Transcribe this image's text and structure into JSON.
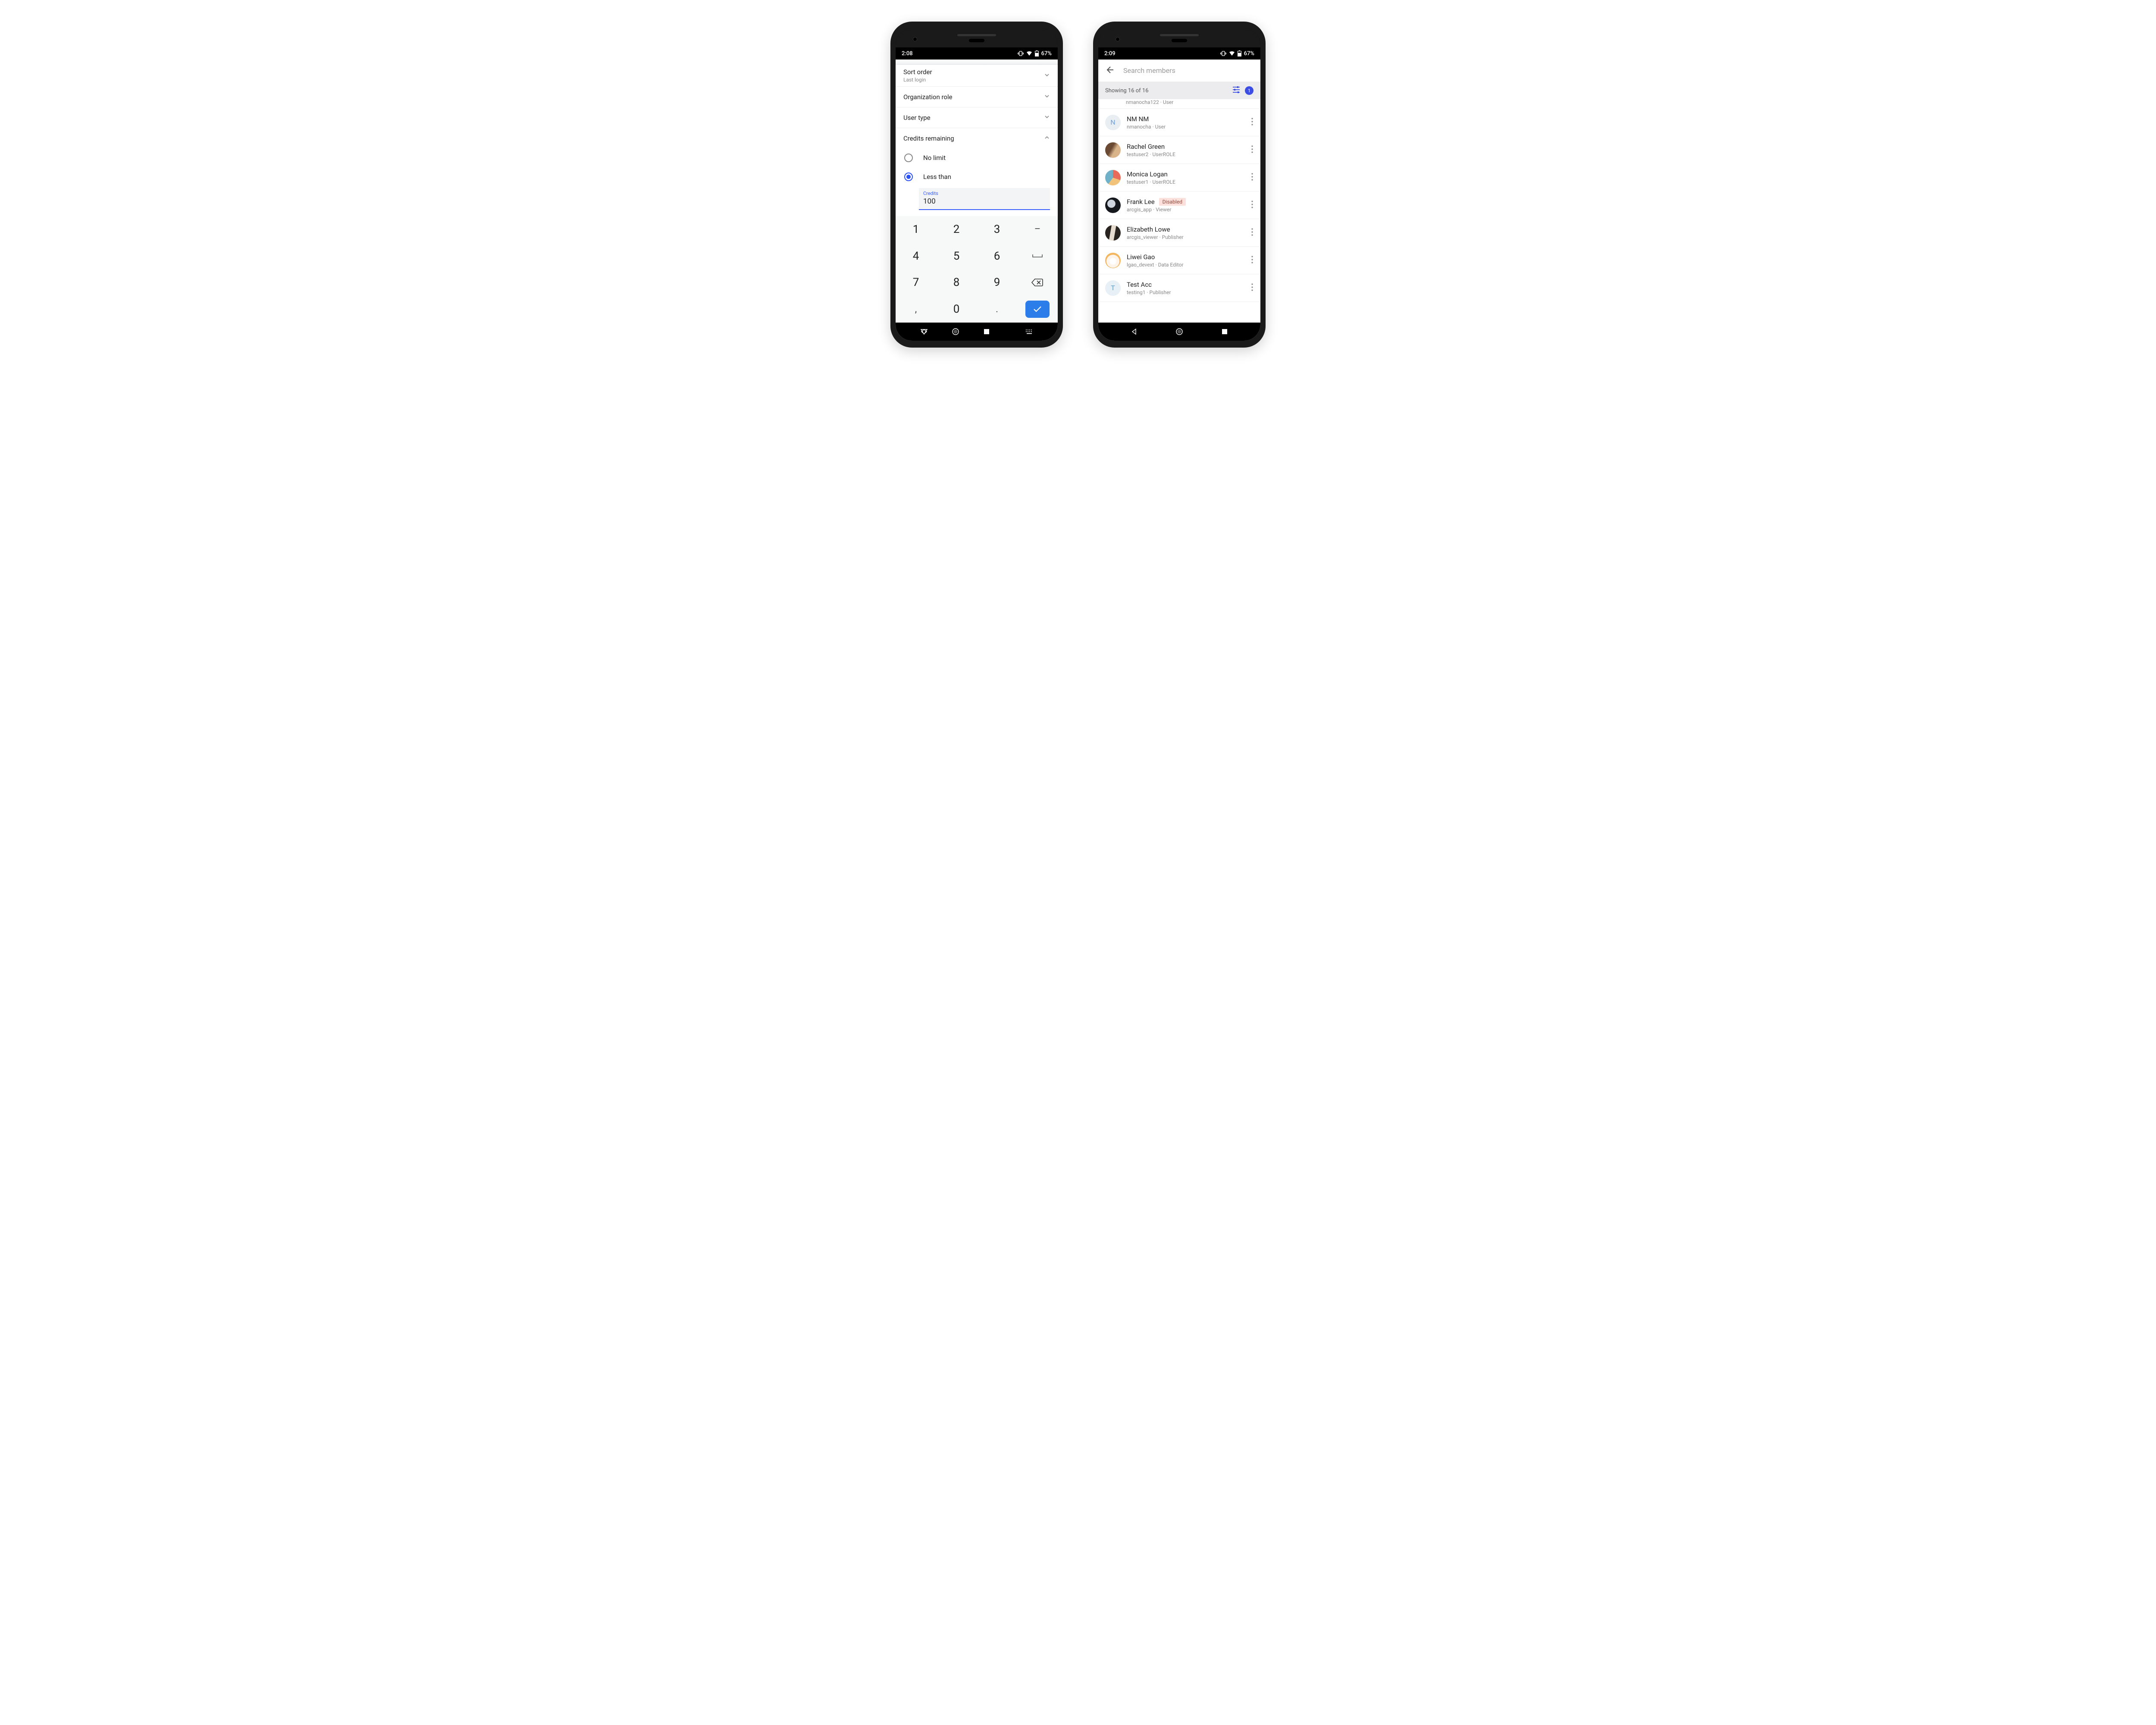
{
  "phone1": {
    "status": {
      "time": "2:08",
      "battery": "67%"
    },
    "filters": {
      "sort_order": {
        "label": "Sort order",
        "value": "Last login"
      },
      "org_role": {
        "label": "Organization role"
      },
      "user_type": {
        "label": "User type"
      },
      "credits": {
        "label": "Credits remaining",
        "options": {
          "no_limit": "No limit",
          "less_than": "Less than"
        },
        "input_caption": "Credits",
        "input_value": "100"
      }
    },
    "keypad": {
      "k1": "1",
      "k2": "2",
      "k3": "3",
      "kdash": "–",
      "k4": "4",
      "k5": "5",
      "k6": "6",
      "k7": "7",
      "k8": "8",
      "k9": "9",
      "kcomma": ",",
      "k0": "0",
      "kdot": "."
    }
  },
  "phone2": {
    "status": {
      "time": "2:09",
      "battery": "67%"
    },
    "search_placeholder": "Search members",
    "summary": {
      "text": "Showing 16 of 16",
      "badge": "1"
    },
    "partial_row_sub": "nmanocha122 · User",
    "members": [
      {
        "name": "NM NM",
        "sub": "nmanocha · User",
        "avatar_class": "av-letter-n",
        "initial": "N",
        "disabled": false
      },
      {
        "name": "Rachel Green",
        "sub": "testuser2 · UserROLE",
        "avatar_class": "av-rachel",
        "initial": "",
        "disabled": false
      },
      {
        "name": "Monica Logan",
        "sub": "testuser1 · UserROLE",
        "avatar_class": "av-monica",
        "initial": "",
        "disabled": false
      },
      {
        "name": "Frank Lee",
        "sub": "arcgis_app · Viewer",
        "avatar_class": "av-frank",
        "initial": "",
        "disabled": true,
        "badge": "Disabled"
      },
      {
        "name": "Elizabeth Lowe",
        "sub": "arcgis_viewer · Publisher",
        "avatar_class": "av-eliz",
        "initial": "",
        "disabled": false
      },
      {
        "name": "Liwei Gao",
        "sub": "lgao_devext · Data Editor",
        "avatar_class": "av-liwei",
        "initial": "",
        "disabled": false
      },
      {
        "name": "Test Acc",
        "sub": "testing1 · Publisher",
        "avatar_class": "av-letter-t",
        "initial": "T",
        "disabled": false
      }
    ]
  }
}
